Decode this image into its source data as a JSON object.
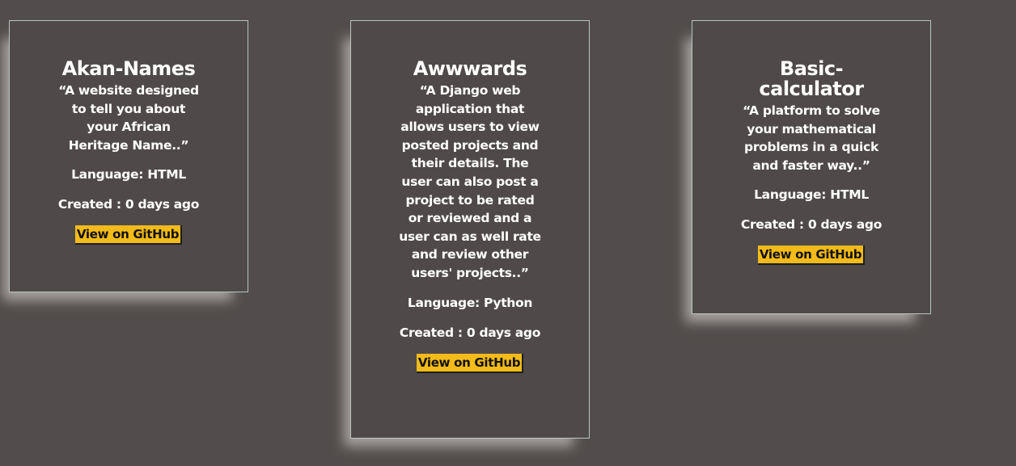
{
  "repos": [
    {
      "name": "Akan-Names",
      "description": "“A website designed to tell you about your African Heritage Name..”",
      "language": "Language: HTML",
      "created": "Created : 0 days ago",
      "link_label": "View on GitHub"
    },
    {
      "name": "Awwwards",
      "description": "“A Django web application that allows users to view posted projects and their details. The user can also post a project to be rated or reviewed and a user can as well rate and review other users' projects..”",
      "language": "Language: Python",
      "created": "Created : 0 days ago",
      "link_label": "View on GitHub"
    },
    {
      "name": "Basic-calculator",
      "description": "“A platform to solve your mathematical problems in a quick and faster way..”",
      "language": "Language: HTML",
      "created": "Created : 0 days ago",
      "link_label": "View on GitHub"
    }
  ],
  "colors": {
    "background": "#524d4c",
    "card_border": "#b8c4c0",
    "button_bg": "#f3bb1a",
    "text": "#ffffff"
  }
}
